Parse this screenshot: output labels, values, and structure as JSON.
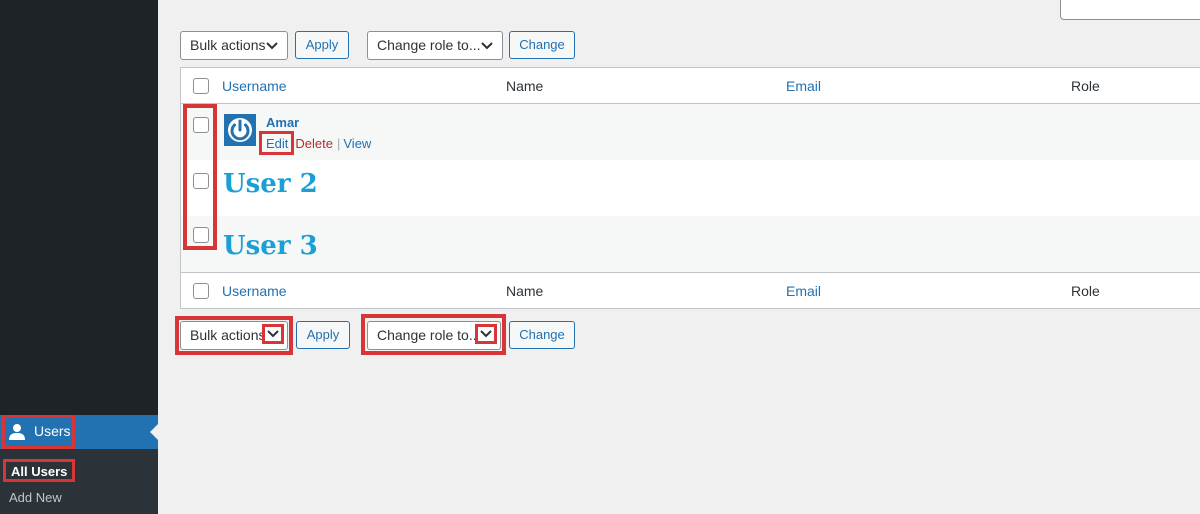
{
  "sidebar": {
    "users_label": "Users",
    "submenu": {
      "all_users": "All Users",
      "add_new": "Add New"
    }
  },
  "top_controls": {
    "bulk_actions": "Bulk actions",
    "apply": "Apply",
    "change_role": "Change role to...",
    "change": "Change"
  },
  "bottom_controls": {
    "bulk_actions": "Bulk actions",
    "apply": "Apply",
    "change_role": "Change role to...",
    "change": "Change"
  },
  "table": {
    "headers": {
      "username": "Username",
      "name": "Name",
      "email": "Email",
      "role": "Role"
    },
    "rows": [
      {
        "username": "Amar",
        "actions": {
          "edit": "Edit",
          "delete": "Delete",
          "sep": "|",
          "view": "View"
        }
      },
      {
        "username": "User 2"
      },
      {
        "username": "User 3"
      }
    ]
  },
  "colors": {
    "accent": "#2271b1",
    "highlight": "#d63638",
    "sidebar": "#1d2327"
  },
  "icons": [
    "user-icon",
    "chevron-down-icon",
    "power-avatar-icon"
  ]
}
